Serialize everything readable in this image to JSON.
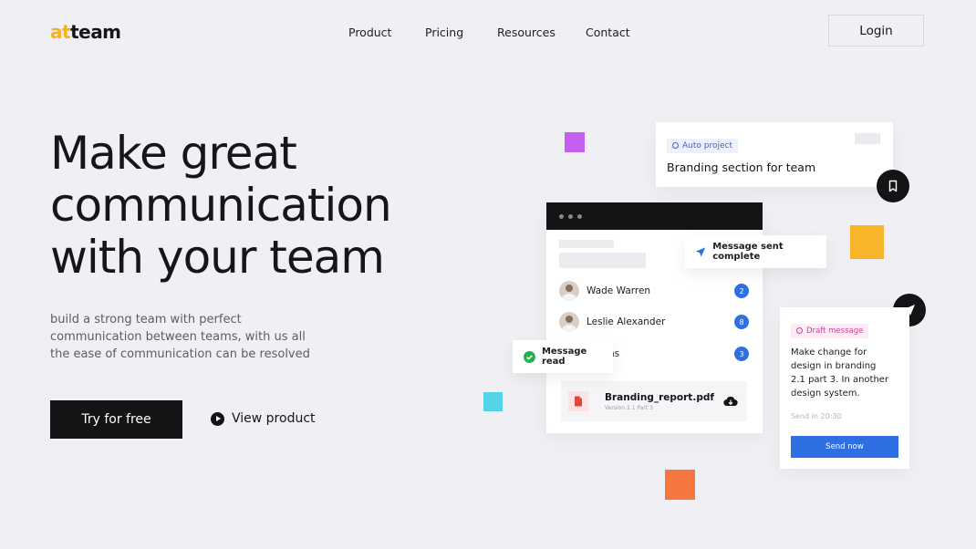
{
  "brand": {
    "logo_accent": "at",
    "logo_rest": "team",
    "accent_color": "#f6b21b"
  },
  "nav": {
    "links": [
      "Product",
      "Pricing",
      "Resources",
      "Contact"
    ],
    "login_label": "Login"
  },
  "hero": {
    "headline_lines": [
      "Make great",
      "communication",
      "with your team"
    ],
    "subtitle": "build a strong team with perfect communication between teams, with us all the ease of communication can be resolved",
    "cta_primary": "Try for free",
    "cta_secondary": "View product"
  },
  "project_card": {
    "tag": "Auto project",
    "title": "Branding section for team"
  },
  "chat_window": {
    "people": [
      {
        "name": "Wade Warren",
        "count": "2"
      },
      {
        "name": "Leslie Alexander",
        "count": "8"
      },
      {
        "name": "awkins",
        "count": "3"
      }
    ],
    "file": {
      "name": "Branding_report.pdf",
      "subtitle": "Version 2.1 Part 3"
    }
  },
  "toasts": {
    "sent": "Message sent complete",
    "read": "Message read"
  },
  "draft_card": {
    "tag": "Draft message",
    "body": "Make change for design in branding 2.1 part 3. In another design system.",
    "time": "Send in 20:30",
    "button": "Send now"
  },
  "colors": {
    "purple": "#c65ef0",
    "yellow": "#f9b52a",
    "cyan": "#55d3e6",
    "orange": "#f5763f",
    "blue": "#2f6fe4",
    "dark": "#141416",
    "green": "#22b14c"
  }
}
